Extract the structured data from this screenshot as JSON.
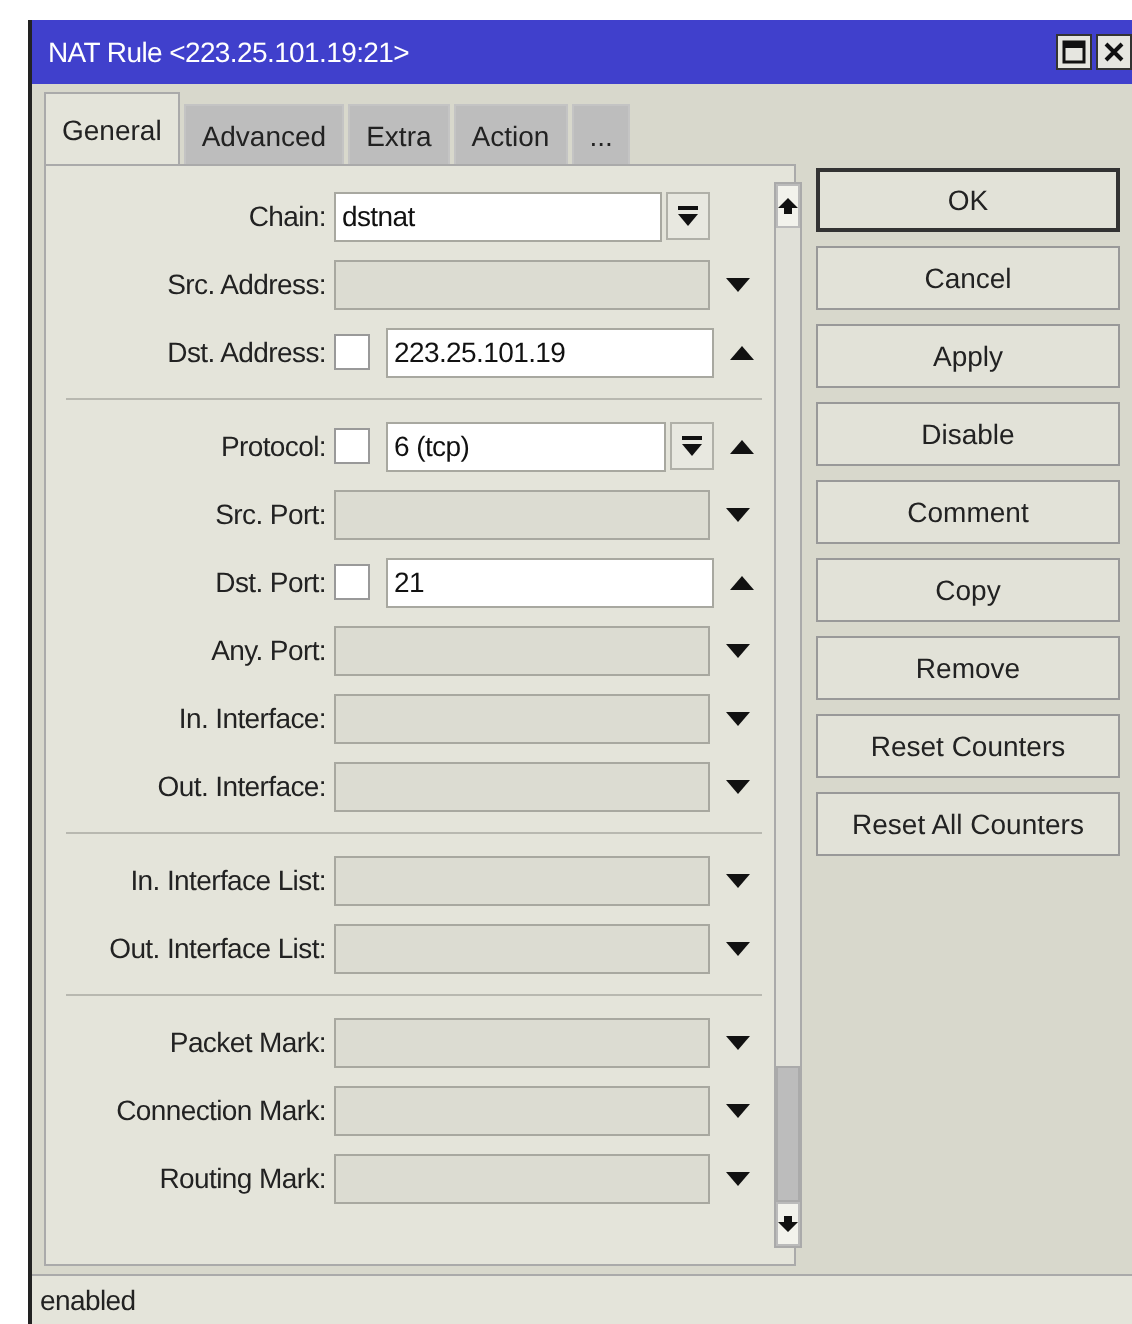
{
  "window": {
    "title": "NAT Rule <223.25.101.19:21>"
  },
  "tabs": [
    {
      "label": "General",
      "selected": true
    },
    {
      "label": "Advanced",
      "selected": false
    },
    {
      "label": "Extra",
      "selected": false
    },
    {
      "label": "Action",
      "selected": false
    },
    {
      "label": "...",
      "selected": false
    }
  ],
  "groups": [
    [
      {
        "kind": "select",
        "label": "Chain:",
        "value": "dstnat"
      },
      {
        "kind": "empty",
        "label": "Src. Address:",
        "expanded": false
      },
      {
        "kind": "value",
        "label": "Dst. Address:",
        "checked": false,
        "value": "223.25.101.19",
        "expanded": true
      }
    ],
    [
      {
        "kind": "combo",
        "label": "Protocol:",
        "checked": false,
        "value": "6 (tcp)",
        "expanded": true
      },
      {
        "kind": "empty",
        "label": "Src. Port:",
        "expanded": false
      },
      {
        "kind": "value",
        "label": "Dst. Port:",
        "checked": false,
        "value": "21",
        "expanded": true
      },
      {
        "kind": "empty",
        "label": "Any. Port:",
        "expanded": false
      },
      {
        "kind": "empty",
        "label": "In. Interface:",
        "expanded": false
      },
      {
        "kind": "empty",
        "label": "Out. Interface:",
        "expanded": false
      }
    ],
    [
      {
        "kind": "empty",
        "label": "In. Interface List:",
        "expanded": false
      },
      {
        "kind": "empty",
        "label": "Out. Interface List:",
        "expanded": false
      }
    ],
    [
      {
        "kind": "empty",
        "label": "Packet Mark:",
        "expanded": false
      },
      {
        "kind": "empty",
        "label": "Connection Mark:",
        "expanded": false
      },
      {
        "kind": "empty",
        "label": "Routing Mark:",
        "expanded": false
      }
    ]
  ],
  "buttons": [
    {
      "label": "OK",
      "default": true
    },
    {
      "label": "Cancel",
      "default": false
    },
    {
      "label": "Apply",
      "default": false
    },
    {
      "label": "Disable",
      "default": false
    },
    {
      "label": "Comment",
      "default": false
    },
    {
      "label": "Copy",
      "default": false
    },
    {
      "label": "Remove",
      "default": false
    },
    {
      "label": "Reset Counters",
      "default": false
    },
    {
      "label": "Reset All Counters",
      "default": false
    }
  ],
  "status_bar": "enabled"
}
